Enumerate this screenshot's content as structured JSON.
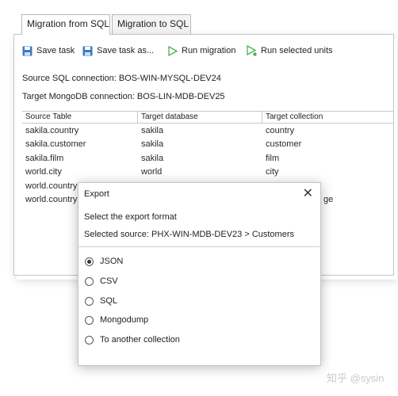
{
  "tabs": [
    {
      "label": "Migration from SQL",
      "active": true
    },
    {
      "label": "Migration to SQL",
      "active": false
    }
  ],
  "toolbar": {
    "save_task": "Save task",
    "save_task_as": "Save task as...",
    "run_migration": "Run migration",
    "run_selected": "Run selected units"
  },
  "connections": {
    "source": "Source SQL connection: BOS-WIN-MYSQL-DEV24",
    "target": "Target MongoDB connection: BOS-LIN-MDB-DEV25"
  },
  "grid": {
    "headers": [
      "Source Table",
      "Target database",
      "Target collection"
    ],
    "rows": [
      [
        "sakila.country",
        "sakila",
        "country"
      ],
      [
        "sakila.customer",
        "sakila",
        "customer"
      ],
      [
        "sakila.film",
        "sakila",
        "film"
      ],
      [
        "world.city",
        "world",
        "city"
      ],
      [
        "world.country",
        "",
        ""
      ],
      [
        "world.countryl",
        "",
        "ge"
      ]
    ]
  },
  "dialog": {
    "title": "Export",
    "close": "✕",
    "heading": "Select the export format",
    "source": "Selected source: PHX-WIN-MDB-DEV23 > Customers",
    "options": [
      {
        "label": "JSON",
        "checked": true
      },
      {
        "label": "CSV",
        "checked": false
      },
      {
        "label": "SQL",
        "checked": false
      },
      {
        "label": "Mongodump",
        "checked": false
      },
      {
        "label": "To another collection",
        "checked": false
      }
    ]
  },
  "watermark": "知乎 @sysin",
  "colors": {
    "run_icon": "#4caf50",
    "save_icon": "#3b78c2"
  }
}
